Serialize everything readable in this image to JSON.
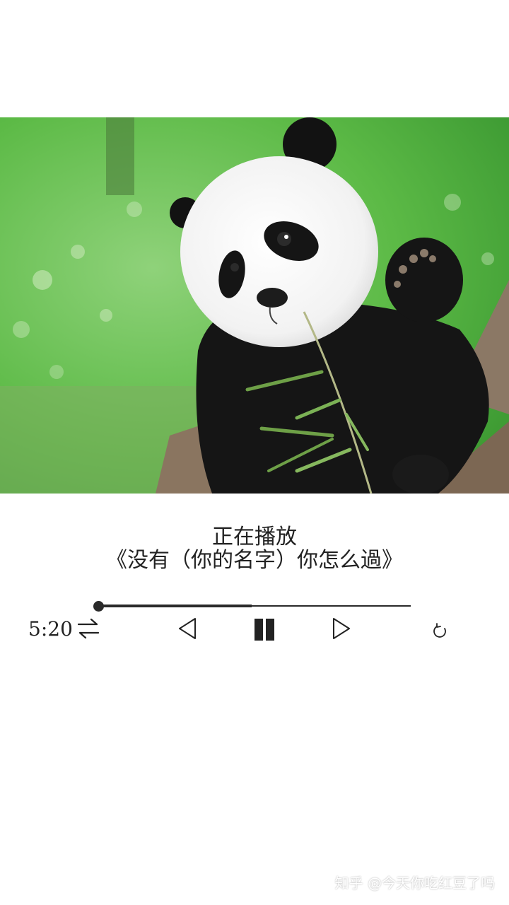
{
  "player": {
    "status_label": "正在播放",
    "song_title": "《没有（你的名字）你怎么過》",
    "current_time": "5:20",
    "progress": 0.49
  },
  "controls": {
    "shuffle_icon": "repeat-arrows-icon",
    "previous_icon": "previous-triangle-icon",
    "pause_icon": "pause-icon",
    "next_icon": "next-triangle-icon",
    "loop_icon": "refresh-icon"
  },
  "artwork": {
    "subject": "giant-panda-photo"
  },
  "watermark": {
    "text": "知乎 @今天你吃红豆了吗"
  }
}
